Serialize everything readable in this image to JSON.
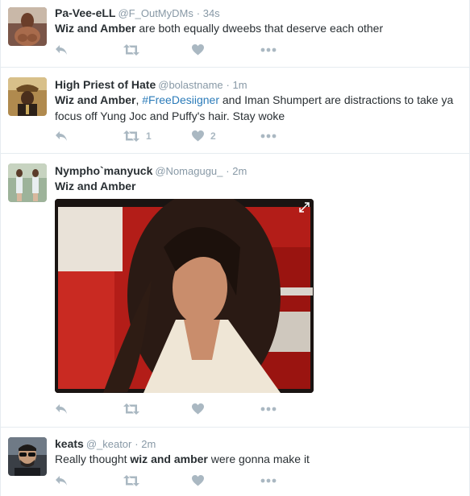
{
  "tweets": [
    {
      "fullname": "Pa-Vee-eLL",
      "username": "@F_OutMyDMs",
      "time": "34s",
      "text": [
        {
          "t": "Wiz and Amber",
          "b": true
        },
        {
          "t": " are both equally dweebs that deserve each other"
        }
      ],
      "retweets": "",
      "likes": ""
    },
    {
      "fullname": "High Priest of Hate",
      "username": "@bolastname",
      "time": "1m",
      "text": [
        {
          "t": "Wiz and Amber",
          "b": true
        },
        {
          "t": ", "
        },
        {
          "t": "#FreeDesiigner",
          "hashtag": true
        },
        {
          "t": " and Iman Shumpert are distractions to take ya focus off Yung Joc and Puffy's hair. Stay woke"
        }
      ],
      "retweets": "1",
      "likes": "2"
    },
    {
      "fullname": "Nympho`manyuck",
      "username": "@Nomagugu_",
      "time": "2m",
      "text": [
        {
          "t": "Wiz and Amber",
          "b": true
        }
      ],
      "retweets": "",
      "likes": ""
    },
    {
      "fullname": "keats",
      "username": "@_keator",
      "time": "2m",
      "text": [
        {
          "t": "Really thought "
        },
        {
          "t": "wiz and amber",
          "b": true
        },
        {
          "t": " were gonna make it"
        }
      ],
      "retweets": "",
      "likes": ""
    }
  ],
  "separator": "·",
  "icons": {
    "reply": "reply-icon",
    "retweet": "retweet-icon",
    "like": "heart-icon",
    "more": "more-icon",
    "expand": "expand-icon"
  },
  "colors": {
    "icon_gray": "#aab8c2",
    "name": "#292f33",
    "meta": "#8899a6",
    "hashtag": "#2b7bb9",
    "divider": "#e6ecf0"
  }
}
